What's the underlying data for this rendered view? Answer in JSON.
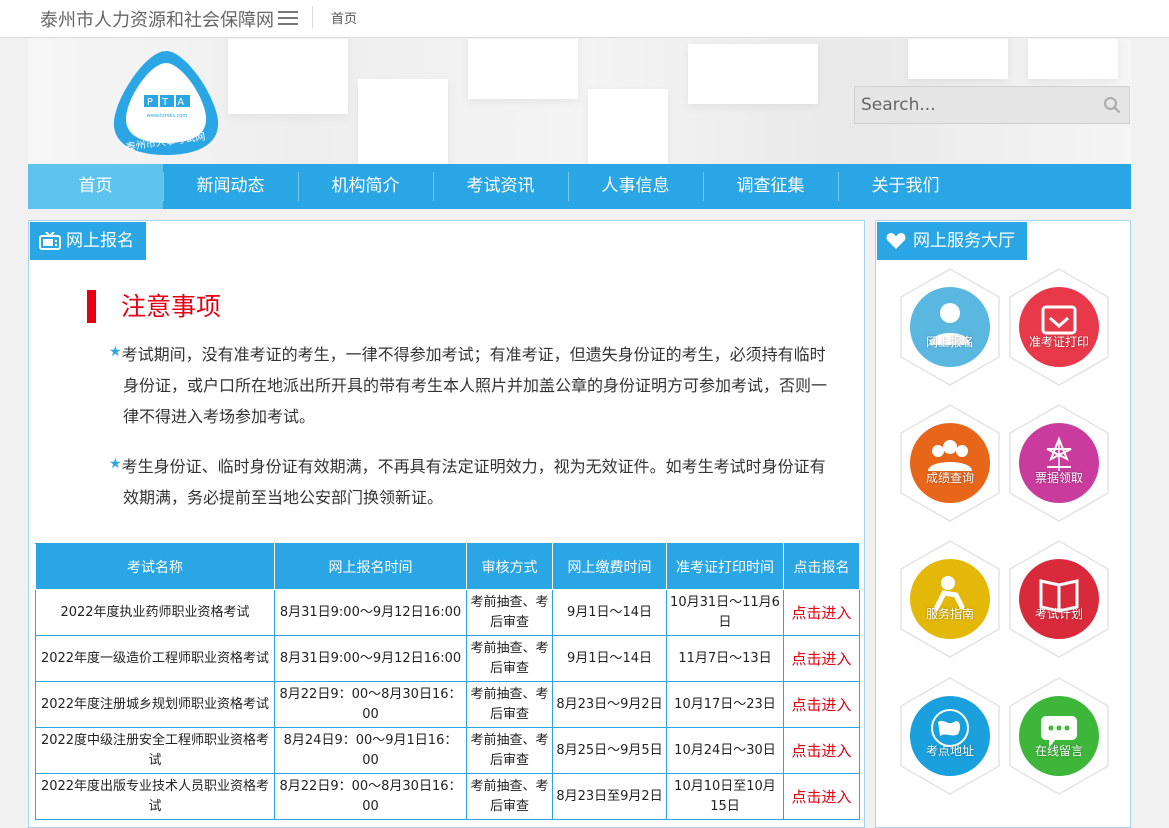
{
  "topbar": {
    "site_title": "泰州市人力资源和社会保障网",
    "home_link": "首页"
  },
  "banner": {
    "logo_letters": "P T A",
    "logo_url_text": "www.tzrsks.com",
    "logo_org": "泰州市人事考试网"
  },
  "search": {
    "placeholder": "Search..."
  },
  "nav": {
    "items": [
      "首页",
      "新闻动态",
      "机构简介",
      "考试资讯",
      "人事信息",
      "调查征集",
      "关于我们"
    ],
    "active_index": 0
  },
  "left_panel": {
    "title": "网上报名",
    "notice_title": "注意事项",
    "paragraphs": [
      "考试期间，没有准考证的考生，一律不得参加考试；有准考证，但遗失身份证的考生，必须持有临时身份证，或户口所在地派出所开具的带有考生本人照片并加盖公章的身份证明方可参加考试，否则一律不得进入考场参加考试。",
      "考生身份证、临时身份证有效期满，不再具有法定证明效力，视为无效证件。如考生考试时身份证有效期满，务必提前至当地公安部门换领新证。"
    ],
    "star_glyph": "★",
    "table": {
      "headers": [
        "考试名称",
        "网上报名时间",
        "审核方式",
        "网上缴费时间",
        "准考证打印时间",
        "点击报名"
      ],
      "rows": [
        [
          "2022年度执业药师职业资格考试",
          "8月31日9:00～9月12日16:00",
          "考前抽查、考后审查",
          "9月1日～14日",
          "10月31日～11月6日",
          "点击进入"
        ],
        [
          "2022年度一级造价工程师职业资格考试",
          "8月31日9:00～9月12日16:00",
          "考前抽查、考后审查",
          "9月1日～14日",
          "11月7日～13日",
          "点击进入"
        ],
        [
          "2022年度注册城乡规划师职业资格考试",
          "8月22日9：00～8月30日16：00",
          "考前抽查、考后审查",
          "8月23日～9月2日",
          "10月17日～23日",
          "点击进入"
        ],
        [
          "2022度中级注册安全工程师职业资格考试",
          "8月24日9：00～9月1日16：00",
          "考前抽查、考后审查",
          "8月25日～9月5日",
          "10月24日～30日",
          "点击进入"
        ],
        [
          "2022年度出版专业技术人员职业资格考试",
          "8月22日9：00～8月30日16：00",
          "考前抽查、考后审查",
          "8月23日至9月2日",
          "10月10日至10月15日",
          "点击进入"
        ]
      ]
    }
  },
  "right_panel": {
    "title": "网上服务大厅",
    "services": [
      {
        "label": "网上报名",
        "color": "#5ab8e0",
        "icon": "person-icon"
      },
      {
        "label": "准考证打印",
        "color": "#e8394a",
        "icon": "ticket-check-icon"
      },
      {
        "label": "成绩查询",
        "color": "#e8661a",
        "icon": "group-icon"
      },
      {
        "label": "票据领取",
        "color": "#c93b9c",
        "icon": "receipt-star-icon"
      },
      {
        "label": "服务指南",
        "color": "#e3b808",
        "icon": "guide-person-icon"
      },
      {
        "label": "考试计划",
        "color": "#d82a3a",
        "icon": "book-icon"
      },
      {
        "label": "考点地址",
        "color": "#1aa0dc",
        "icon": "globe-icon"
      },
      {
        "label": "在线留言",
        "color": "#3db63a",
        "icon": "chat-icon"
      }
    ]
  },
  "colors": {
    "primary": "#2ba6e4",
    "nav_active": "#5fc3f0",
    "alert_red": "#e60012"
  }
}
